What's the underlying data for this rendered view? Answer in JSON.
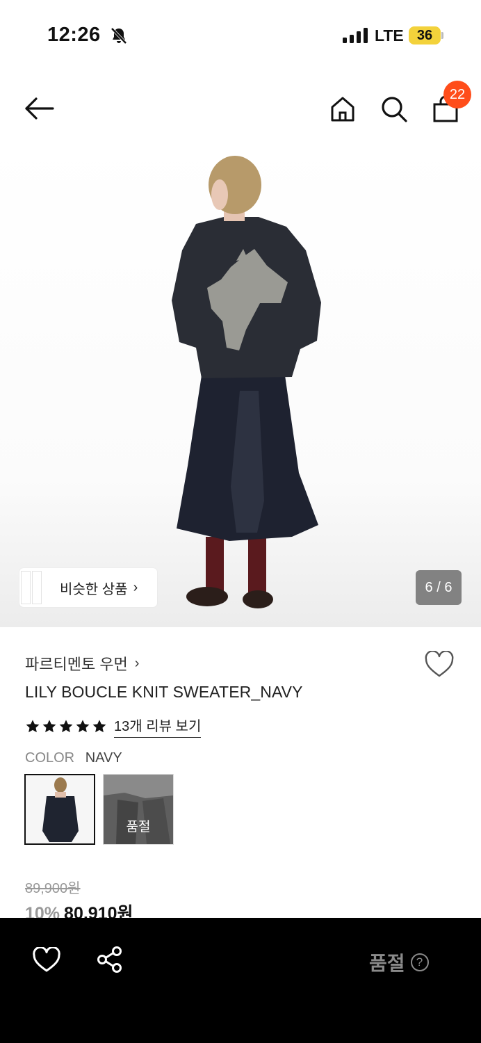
{
  "status_bar": {
    "time": "12:26",
    "network": "LTE",
    "battery": "36"
  },
  "nav": {
    "cart_count": "22"
  },
  "gallery": {
    "similar_label": "비슷한 상품",
    "counter": "6 / 6"
  },
  "product": {
    "brand": "파르티멘토 우먼",
    "name": "LILY BOUCLE KNIT SWEATER_NAVY",
    "rating": 5,
    "review_link": "13개 리뷰 보기",
    "color_label": "COLOR",
    "color_value": "NAVY",
    "swatch_soldout": "품절",
    "original_price": "89,900원",
    "discount": "10%",
    "price": "80,910원"
  },
  "bottom_bar": {
    "status": "품절",
    "help": "?"
  },
  "colors": {
    "badge": "#ff4d1a",
    "battery": "#f3d23b",
    "bottom_bar": "#000000"
  }
}
